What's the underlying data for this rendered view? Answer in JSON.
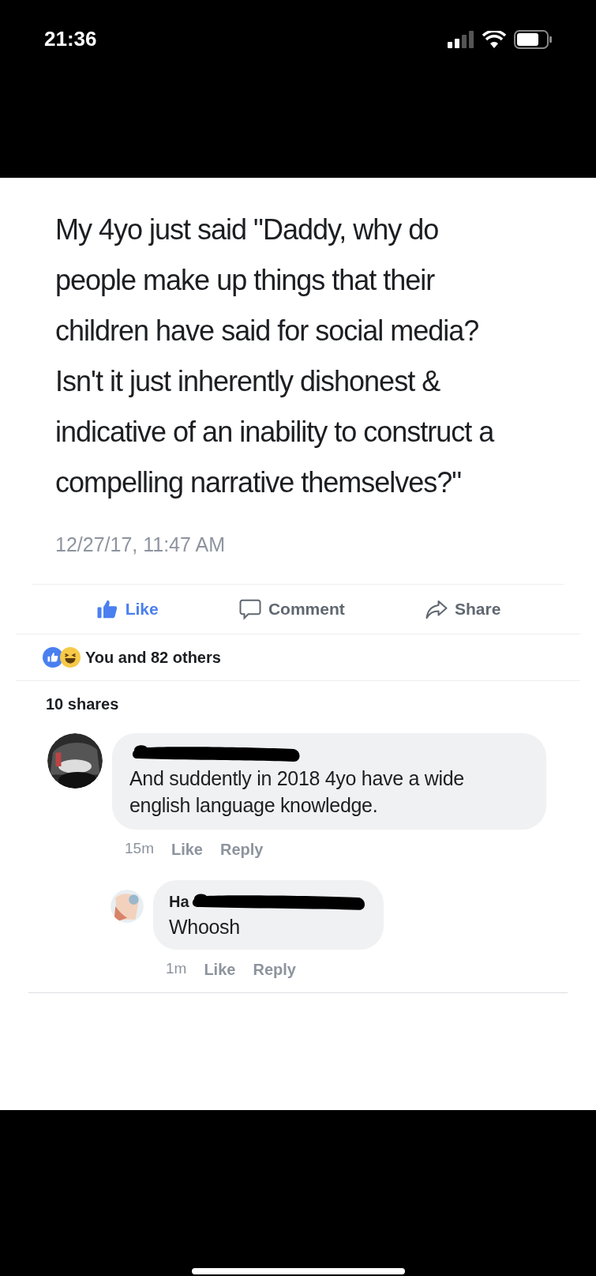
{
  "status_bar": {
    "time": "21:36"
  },
  "post": {
    "text": "My 4yo just said \"Daddy, why do  people make up things that their children have said for social media? Isn't it just inherently dishonest & indicative of an inability to construct a compelling narrative themselves?\"",
    "timestamp": "12/27/17, 11:47 AM"
  },
  "actions": [
    {
      "kind": "like",
      "label": "Like",
      "selected": true
    },
    {
      "kind": "comment",
      "label": "Comment",
      "selected": false
    },
    {
      "kind": "share",
      "label": "Share",
      "selected": false
    }
  ],
  "reactions": {
    "summary": "You and 82 others"
  },
  "shares": "10 shares",
  "comments": [
    {
      "text": "And suddently in 2018 4yo have a wide english language knowledge.",
      "time": "15m",
      "like": "Like",
      "reply": "Reply",
      "is_reply": false
    },
    {
      "author": "Ha",
      "text": "Whoosh",
      "time": "1m",
      "like": "Like",
      "reply": "Reply",
      "is_reply": true
    }
  ]
}
